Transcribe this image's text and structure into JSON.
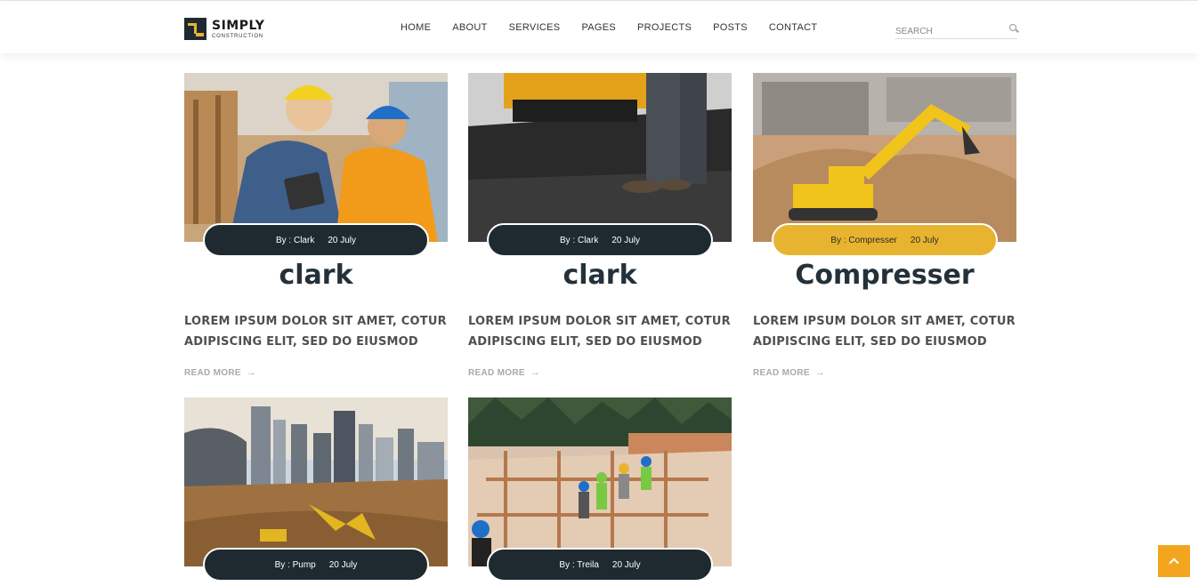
{
  "brand": {
    "name": "SIMPLY",
    "tagline": "CONSTRUCTION"
  },
  "nav": [
    "HOME",
    "ABOUT",
    "SERVICES",
    "PAGES",
    "PROJECTS",
    "POSTS",
    "CONTACT"
  ],
  "search": {
    "placeholder": "SEARCH"
  },
  "posts": [
    {
      "author": "By : Clark",
      "date": "20 July",
      "title": "clark",
      "excerpt": "LOREM IPSUM DOLOR SIT AMET, COTUR ADIPISCING ELIT, SED DO EIUSMOD",
      "read_more": "READ MORE",
      "badge_style": "dark"
    },
    {
      "author": "By : Clark",
      "date": "20 July",
      "title": "clark",
      "excerpt": "LOREM IPSUM DOLOR SIT AMET, COTUR ADIPISCING ELIT, SED DO EIUSMOD",
      "read_more": "READ MORE",
      "badge_style": "dark"
    },
    {
      "author": "By : Compresser",
      "date": "20 July",
      "title": "Compresser",
      "excerpt": "LOREM IPSUM DOLOR SIT AMET, COTUR ADIPISCING ELIT, SED DO EIUSMOD",
      "read_more": "READ MORE",
      "badge_style": "gold"
    },
    {
      "author": "By : Pump",
      "date": "20 July",
      "badge_style": "dark"
    },
    {
      "author": "By : Treila",
      "date": "20 July",
      "badge_style": "dark"
    }
  ],
  "colors": {
    "accent": "#e8b42f",
    "dark": "#1e2a2f",
    "scroll_top": "#f3a61d"
  }
}
